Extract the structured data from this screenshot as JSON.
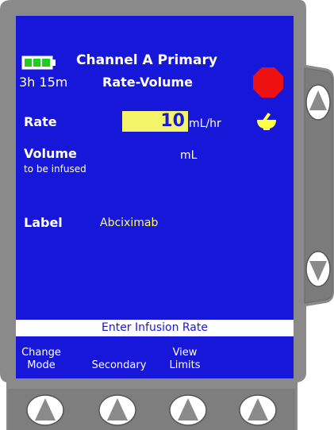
{
  "colors": {
    "screen_bg": "#1717d9",
    "device_gray": "#8a8a8a",
    "highlight_yellow": "#f4f46a",
    "label_yellow": "#ffff66",
    "stop_red": "#ee1111"
  },
  "header": {
    "channel_title": "Channel A Primary",
    "mode": "Rate-Volume",
    "battery_time": "3h 15m",
    "battery_icon": "battery-full-icon",
    "stop_icon": "stop-octagon-icon"
  },
  "rate": {
    "label": "Rate",
    "value": "10",
    "unit": "mL/hr",
    "drug_icon": "mortar-pestle-icon"
  },
  "volume": {
    "label": "Volume",
    "sublabel": "to be infused",
    "value": "",
    "unit": "mL"
  },
  "drug_label": {
    "label": "Label",
    "value": "Abciximab"
  },
  "status": {
    "message": "Enter Infusion Rate"
  },
  "softkeys": [
    {
      "line1": "Change",
      "line2": "Mode"
    },
    {
      "line1": "",
      "line2": "Secondary"
    },
    {
      "line1": "View",
      "line2": "Limits"
    },
    {
      "line1": "",
      "line2": ""
    }
  ],
  "side_buttons": {
    "up_icon": "arrow-up-icon",
    "down_icon": "arrow-down-icon"
  }
}
